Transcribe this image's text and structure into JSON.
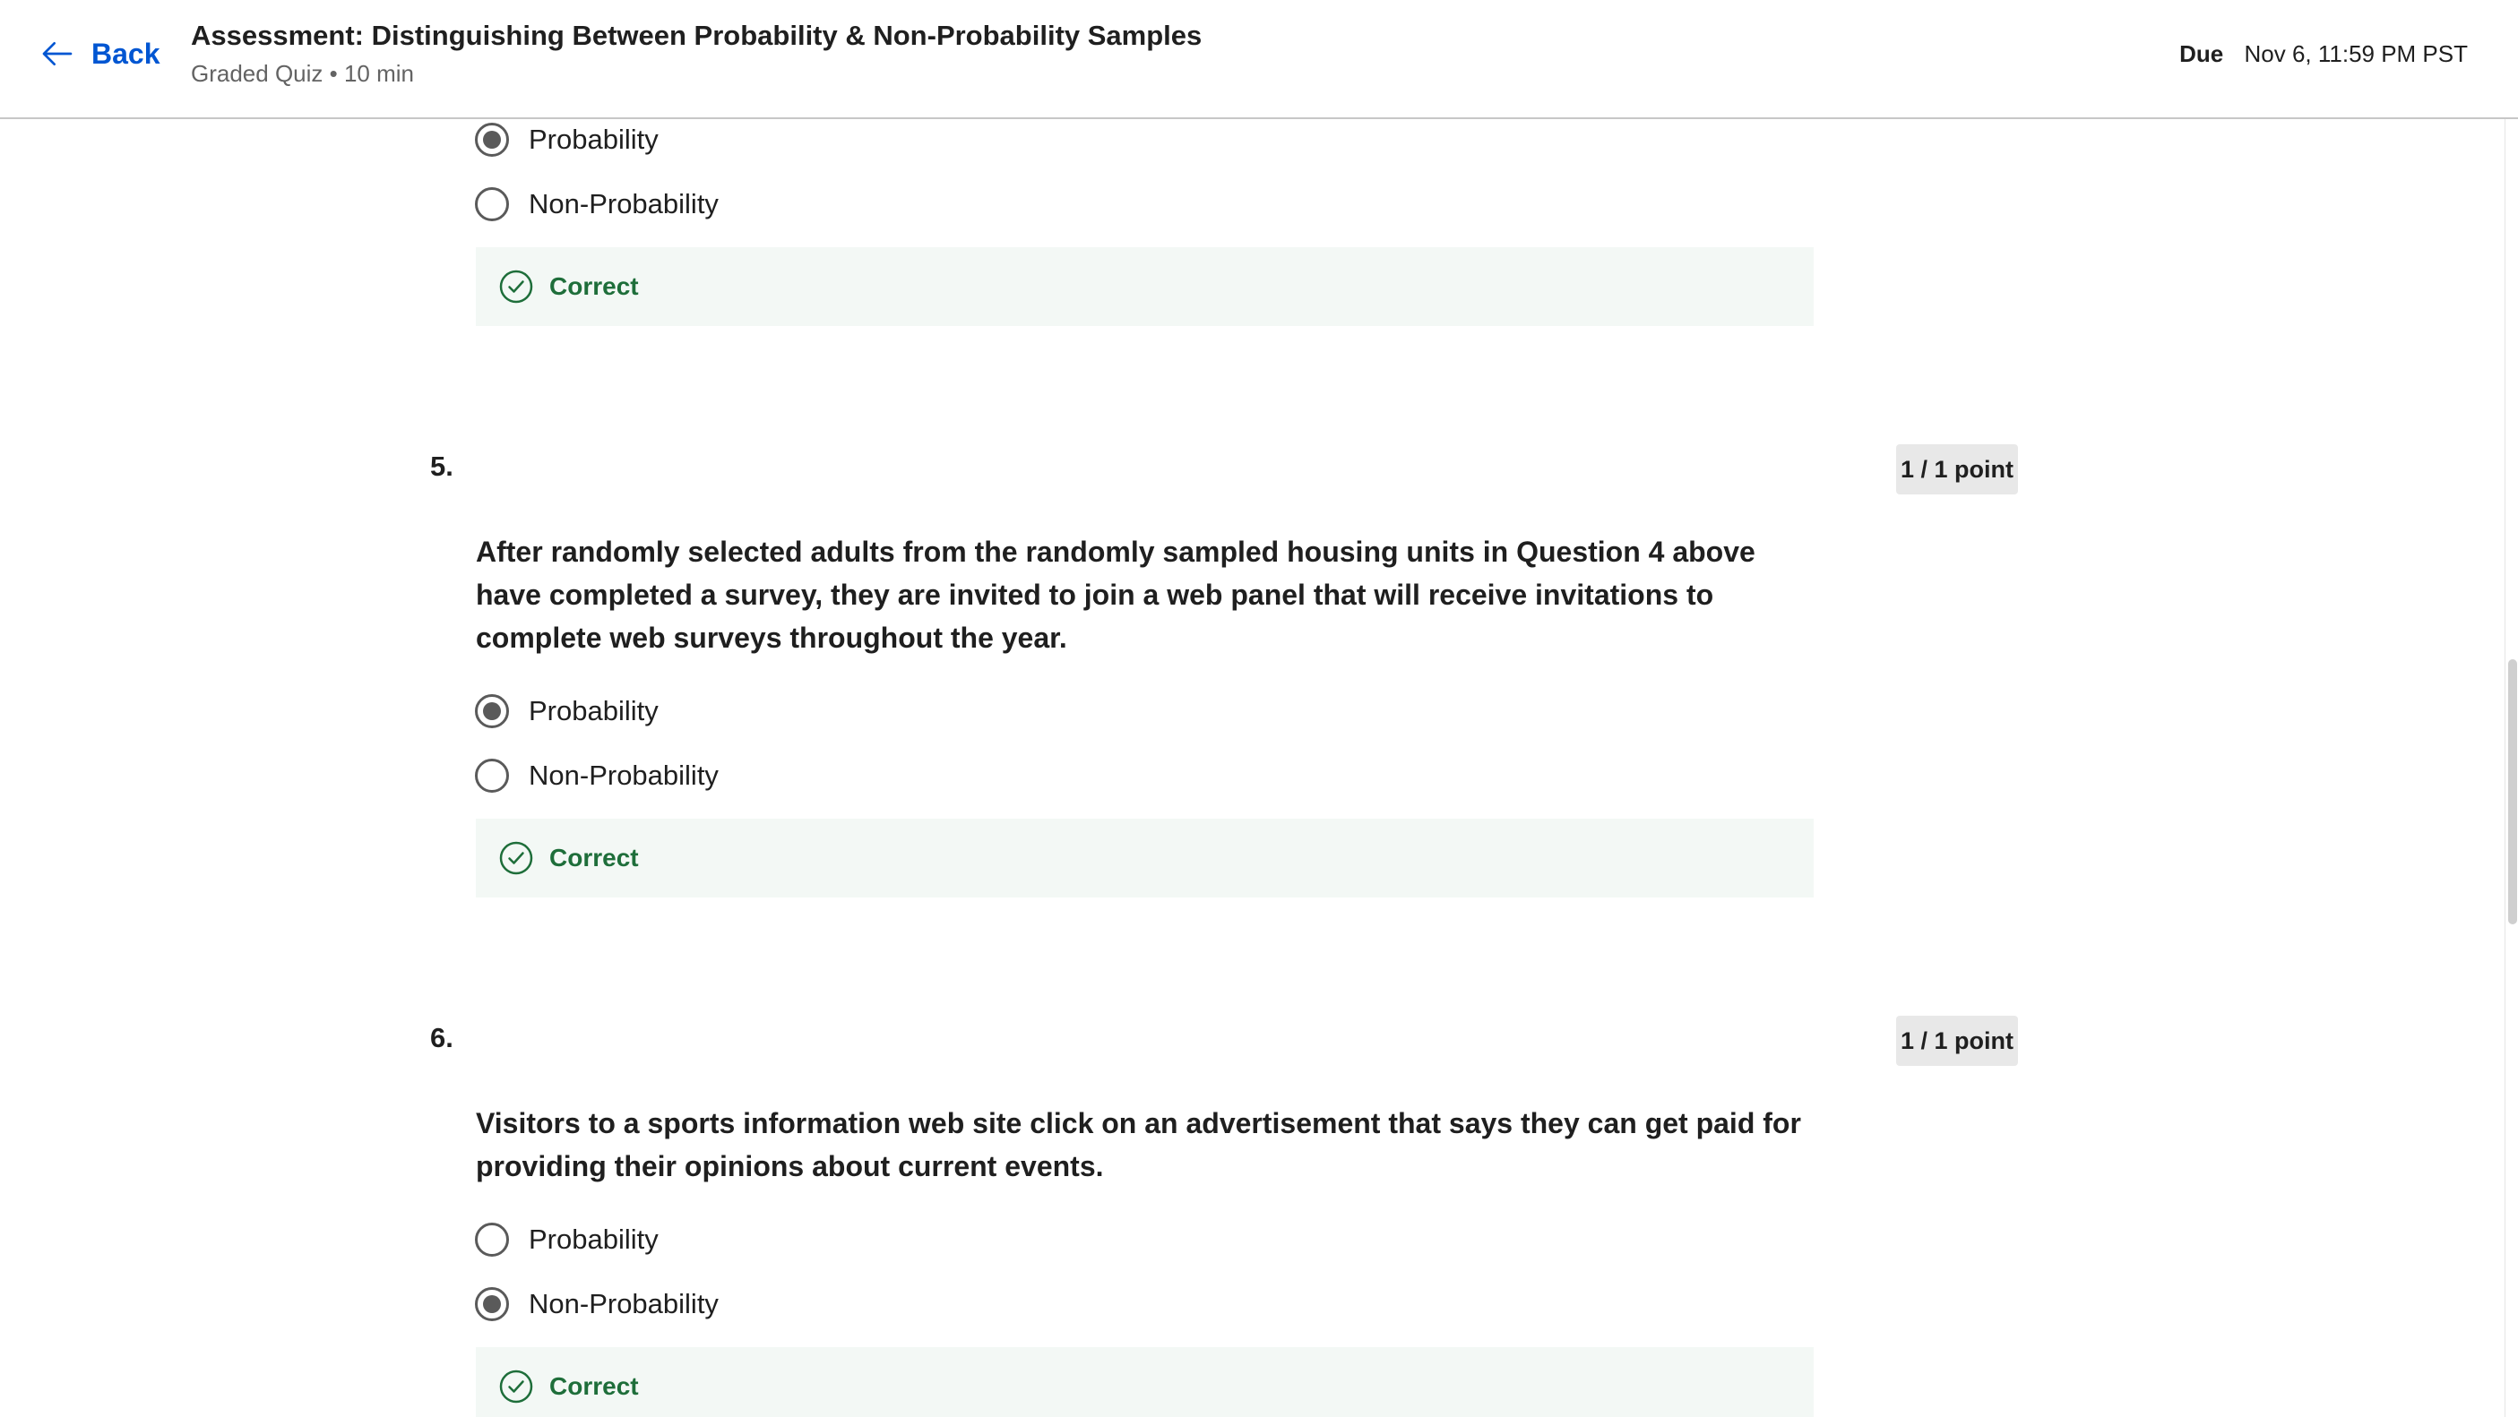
{
  "header": {
    "back_label": "Back",
    "title": "Assessment: Distinguishing Between Probability & Non-Probability Samples",
    "meta": "Graded Quiz • 10 min",
    "due_label": "Due",
    "due_value": "Nov 6, 11:59 PM PST"
  },
  "question_4_partial": {
    "options": [
      {
        "label": "Probability",
        "selected": true
      },
      {
        "label": "Non-Probability",
        "selected": false
      }
    ],
    "feedback": "Correct"
  },
  "question_5": {
    "number": "5.",
    "points": "1 / 1 point",
    "text": "After randomly selected adults from the randomly sampled housing units in Question 4 above have completed a survey, they are invited to join a web panel that will receive invitations to complete web surveys throughout the year.",
    "options": [
      {
        "label": "Probability",
        "selected": true
      },
      {
        "label": "Non-Probability",
        "selected": false
      }
    ],
    "feedback": "Correct"
  },
  "question_6": {
    "number": "6.",
    "points": "1 / 1 point",
    "text": "Visitors to a sports information web site click on an advertisement that says they can get paid for providing their opinions about current events.",
    "options": [
      {
        "label": "Probability",
        "selected": false
      },
      {
        "label": "Non-Probability",
        "selected": true
      }
    ],
    "feedback": "Correct"
  },
  "colors": {
    "link_blue": "#0056d2",
    "correct_green": "#1e6e3a",
    "feedback_bg": "#f3f8f5",
    "points_bg": "#e8e8e8"
  },
  "icons": {
    "back": "arrow-left-icon",
    "feedback": "check-circle-icon"
  }
}
